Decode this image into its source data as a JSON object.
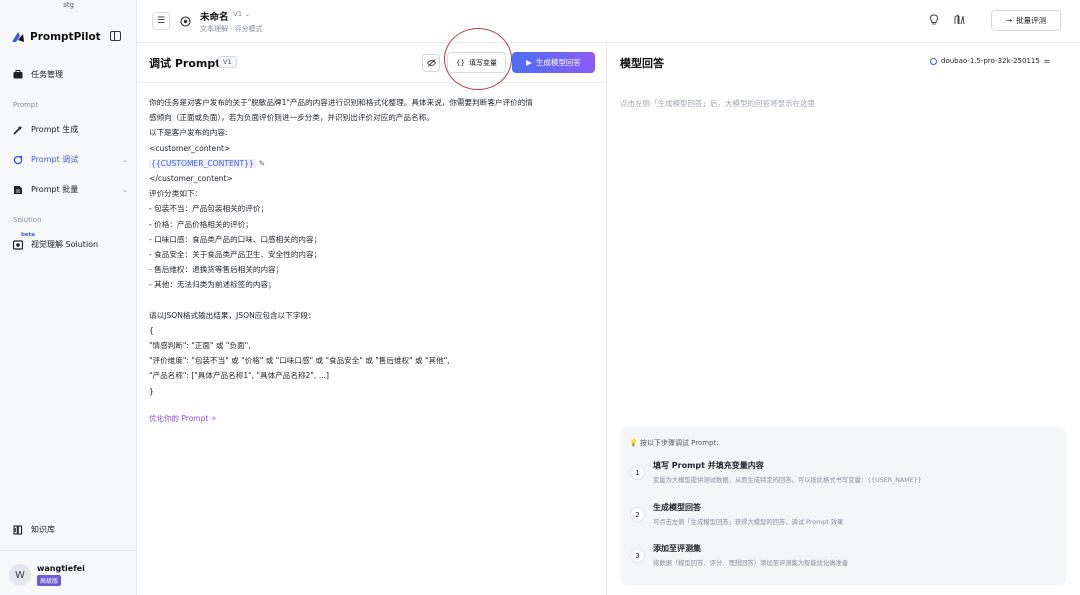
{
  "sidebar": {
    "env": "stg",
    "brand": "PromptPilot",
    "nav": {
      "task": "任务管理",
      "section_prompt": "Prompt",
      "prompt_gen": "Prompt 生成",
      "prompt_debug": "Prompt 调试",
      "prompt_batch": "Prompt 批量",
      "section_solution": "Solution",
      "beta": "beta",
      "visual": "视觉理解 Solution",
      "kb": "知识库"
    },
    "user": {
      "name": "wangtiefei",
      "avatar": "W",
      "badge": "高级版"
    }
  },
  "topbar": {
    "title": "未命名",
    "version": "V1",
    "subtitle": "文本理解 · 评分模式",
    "batch_eval": "批量评测"
  },
  "debug": {
    "title": "调试 Prompt",
    "version": "V1",
    "fill_vars": "填写变量",
    "generate": "生成模型回答",
    "optimize": "优化你的 Prompt"
  },
  "prompt_lines": [
    "你的任务是对客户发布的关于\"脱敏品牌1\"产品的内容进行识别和格式化整理。具体来说，你需要判断客户评价的情",
    "感倾向（正面或负面），若为负面评价则进一步分类，并识别出评价对应的产品名称。",
    "以下是客户发布的内容:",
    "<customer_content>",
    "{{CUSTOMER_CONTENT}}",
    "</customer_content>",
    "评价分类如下：",
    "- 包装不当：产品包装相关的评价；",
    "- 价格：产品价格相关的评价；",
    "- 口味口感：食品类产品的口味、口感相关的内容；",
    "- 食品安全：关于食品类产品卫生、安全性的内容；",
    "- 售后维权：退换货等售后相关的内容；",
    "- 其他：无法归类为前述标签的内容；",
    "",
    "请以JSON格式输出结果，JSON应包含以下字段：",
    "{",
    "    \"情感判断\": \"正面\" 或 \"负面\",",
    "    \"评价维度\": \"包装不当\" 或 \"价格\" 或 \"口味口感\" 或 \"食品安全\" 或 \"售后维权\" 或 \"其他\",",
    "    \"产品名称\": [\"具体产品名称1\", \"具体产品名称2\", ...]",
    "}"
  ],
  "response": {
    "title": "模型回答",
    "model": "doubao-1.5-pro-32k-250115",
    "placeholder": "点击左侧「生成模型回答」后，大模型的回答将显示在这里",
    "steps_head": "按以下步骤调试 Prompt:",
    "steps": [
      {
        "num": "1",
        "title": "填写 Prompt 并填充变量内容",
        "desc": "变量为大模型提供测试数据，从而生成特定的回答。可以按此格式书写变量：{{USER_NAME}}"
      },
      {
        "num": "2",
        "title": "生成模型回答",
        "desc": "可点击左侧「生成模型回答」获得大模型的回答，调试 Prompt 效果"
      },
      {
        "num": "3",
        "title": "添加至评测集",
        "desc": "将数据（模型回答、评分、理想回答）添加至评测集为智能优化做准备"
      }
    ]
  },
  "colors": {
    "accent": "#3b5bdb",
    "gradient_start": "#4d6ef7",
    "gradient_end": "#8b5cf6",
    "annotation": "#b0413e"
  }
}
